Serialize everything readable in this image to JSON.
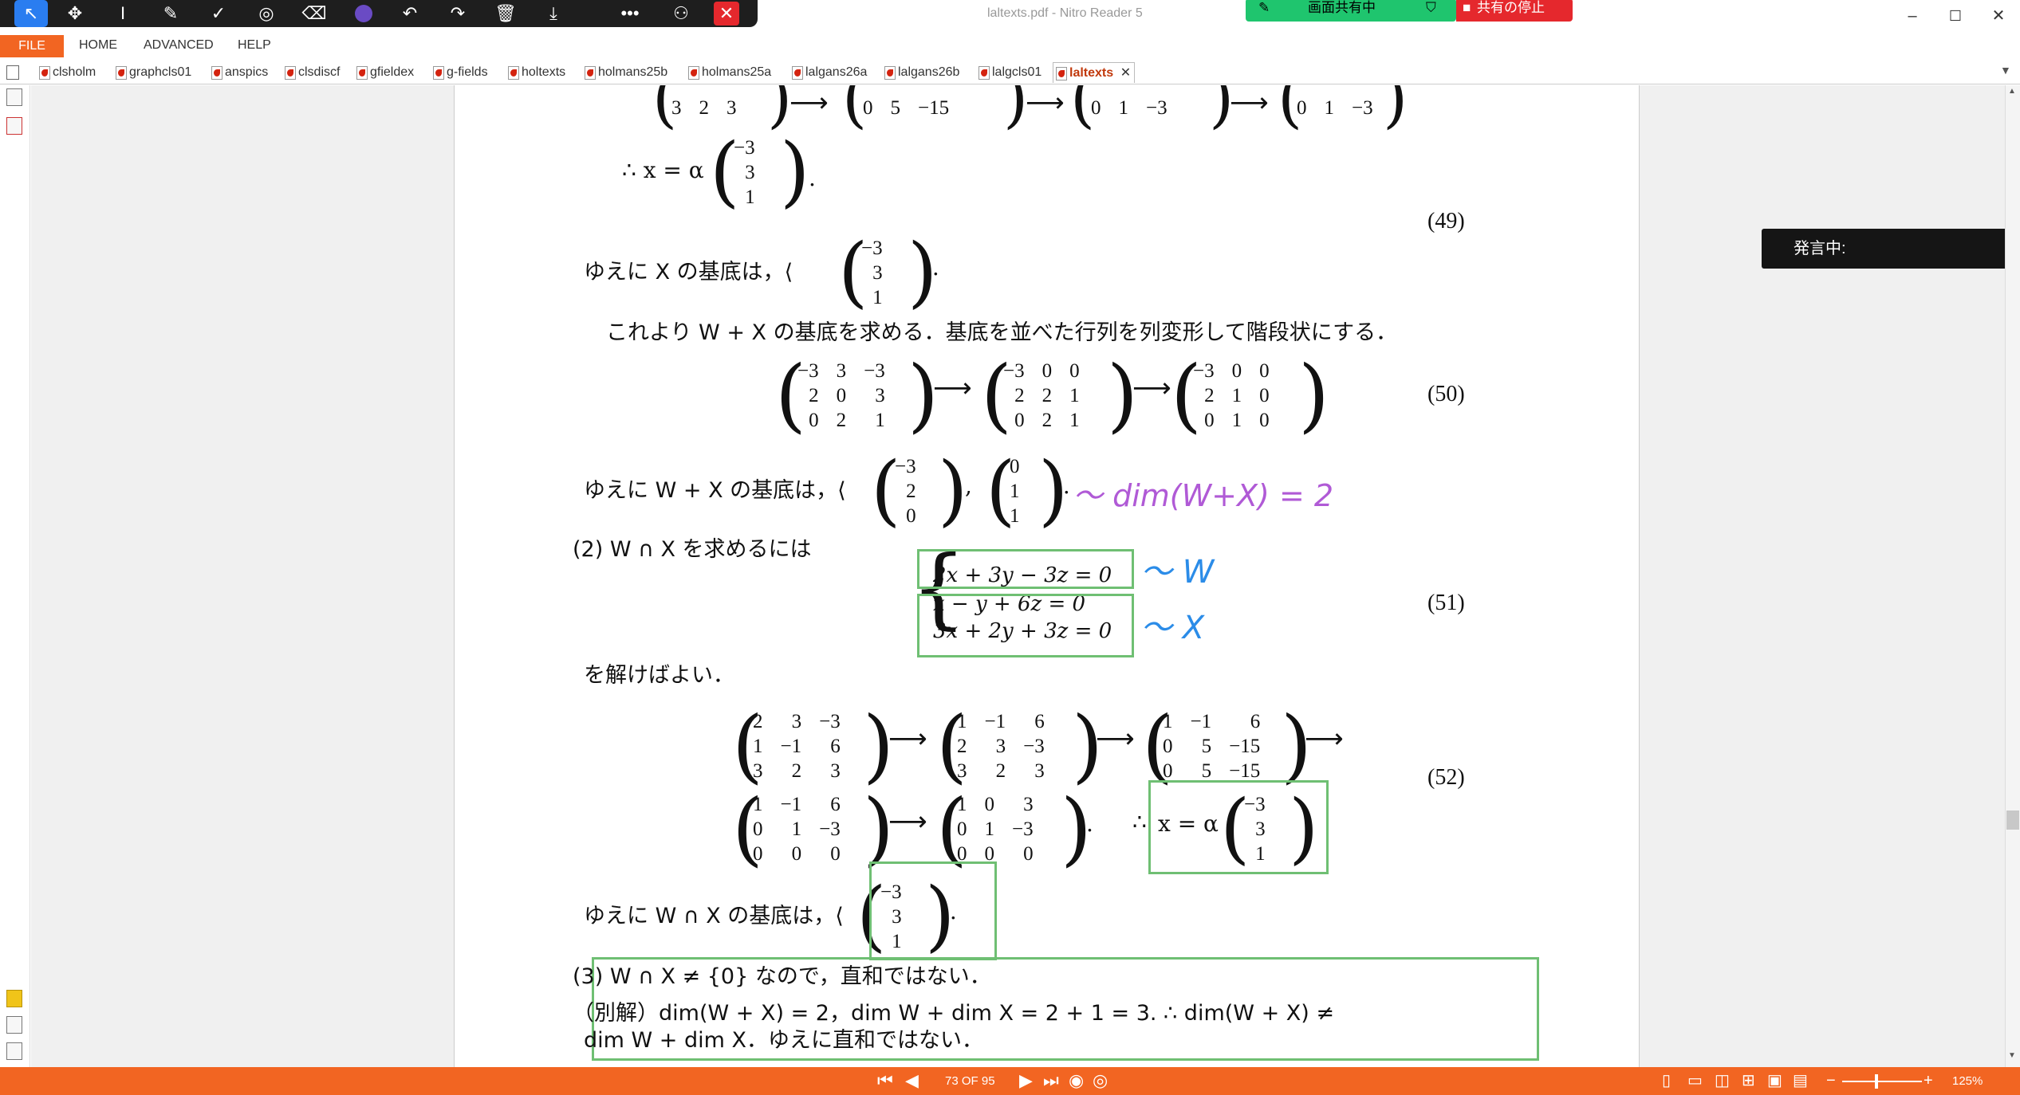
{
  "window": {
    "title": "laltexts.pdf - Nitro Reader 5",
    "minimize": "–",
    "maximize": "☐",
    "close": "✕"
  },
  "share": {
    "status": "画面共有中",
    "stop": "共有の停止"
  },
  "speaking": "発言中:",
  "menu": {
    "file": "FILE",
    "home": "HOME",
    "advanced": "ADVANCED",
    "help": "HELP"
  },
  "tabs": [
    {
      "label": "clsholm"
    },
    {
      "label": "graphcls01"
    },
    {
      "label": "anspics"
    },
    {
      "label": "clsdiscf"
    },
    {
      "label": "gfieldex"
    },
    {
      "label": "g-fields"
    },
    {
      "label": "holtexts"
    },
    {
      "label": "holmans25b"
    },
    {
      "label": "holmans25a"
    },
    {
      "label": "lalgans26a"
    },
    {
      "label": "lalgans26b"
    },
    {
      "label": "lalgcls01"
    },
    {
      "label": "laltexts"
    }
  ],
  "status": {
    "page": "73 OF 95",
    "zoom": "125%"
  },
  "doc": {
    "eq49_therefore": "∴  x = α",
    "vec_m3_3_1": [
      "−3",
      "3",
      "1"
    ],
    "eq49": "(49)",
    "basisX_pre": "ゆえに X の基底は，⟨",
    "basisX_post": "⟩.",
    "para_wx": "これより W + X の基底を求める．基底を並べた行列を列変形して階段状にする．",
    "m50a": [
      [
        "−3",
        "3",
        "−3"
      ],
      [
        "2",
        "0",
        "3"
      ],
      [
        "0",
        "2",
        "1"
      ]
    ],
    "m50b": [
      [
        "−3",
        "0",
        "0"
      ],
      [
        "2",
        "2",
        "1"
      ],
      [
        "0",
        "2",
        "1"
      ]
    ],
    "m50c": [
      [
        "−3",
        "0",
        "0"
      ],
      [
        "2",
        "1",
        "0"
      ],
      [
        "0",
        "1",
        "0"
      ]
    ],
    "eq50": "(50)",
    "basisWX_pre": "ゆえに W + X の基底は，⟨",
    "vec_m3_2_0": [
      "−3",
      "2",
      "0"
    ],
    "vec_0_1_1": [
      "0",
      "1",
      "1"
    ],
    "basisWX_post": "⟩.",
    "part2": "(2)  W ∩ X を求めるには",
    "sys1": "2x + 3y − 3z = 0",
    "sys2": "x − y + 6z = 0",
    "sys3": "3x + 2y + 3z = 0",
    "eq51": "(51)",
    "solve": "を解けばよい．",
    "m52a": [
      [
        "2",
        "3",
        "−3"
      ],
      [
        "1",
        "−1",
        "6"
      ],
      [
        "3",
        "2",
        "3"
      ]
    ],
    "m52b": [
      [
        "1",
        "−1",
        "6"
      ],
      [
        "2",
        "3",
        "−3"
      ],
      [
        "3",
        "2",
        "3"
      ]
    ],
    "m52c": [
      [
        "1",
        "−1",
        "6"
      ],
      [
        "0",
        "5",
        "−15"
      ],
      [
        "0",
        "5",
        "−15"
      ]
    ],
    "m52d": [
      [
        "1",
        "−1",
        "6"
      ],
      [
        "0",
        "1",
        "−3"
      ],
      [
        "0",
        "0",
        "0"
      ]
    ],
    "m52e": [
      [
        "1",
        "0",
        "3"
      ],
      [
        "0",
        "1",
        "−3"
      ],
      [
        "0",
        "0",
        "0"
      ]
    ],
    "eq52_therefore": "∴",
    "eq52_x": "x = α",
    "eq52": "(52)",
    "basisWnX_pre": "ゆえに W ∩ X の基底は，⟨",
    "basisWnX_post": "⟩.",
    "part3": "(3)  W ∩ X ≠ {0} なので，直和ではない．",
    "alt1": "（別解）dim(W + X)  =  2，dim W + dim X  =  2 + 1  =  3.     ∴   dim(W + X)  ≠",
    "alt2": "dim W + dim X．ゆえに直和ではない．",
    "top_m1": [
      [
        "3",
        "2",
        "3"
      ]
    ],
    "top_m2": [
      [
        "0",
        "5",
        "−15"
      ]
    ],
    "top_m3": [
      [
        "0",
        "1",
        "−3"
      ]
    ],
    "top_m4": [
      [
        "0",
        "1",
        "−3"
      ]
    ],
    "ink_dim": "〜 dim(W+X) = 2",
    "ink_W": "〜 W",
    "ink_X": "〜 X"
  }
}
